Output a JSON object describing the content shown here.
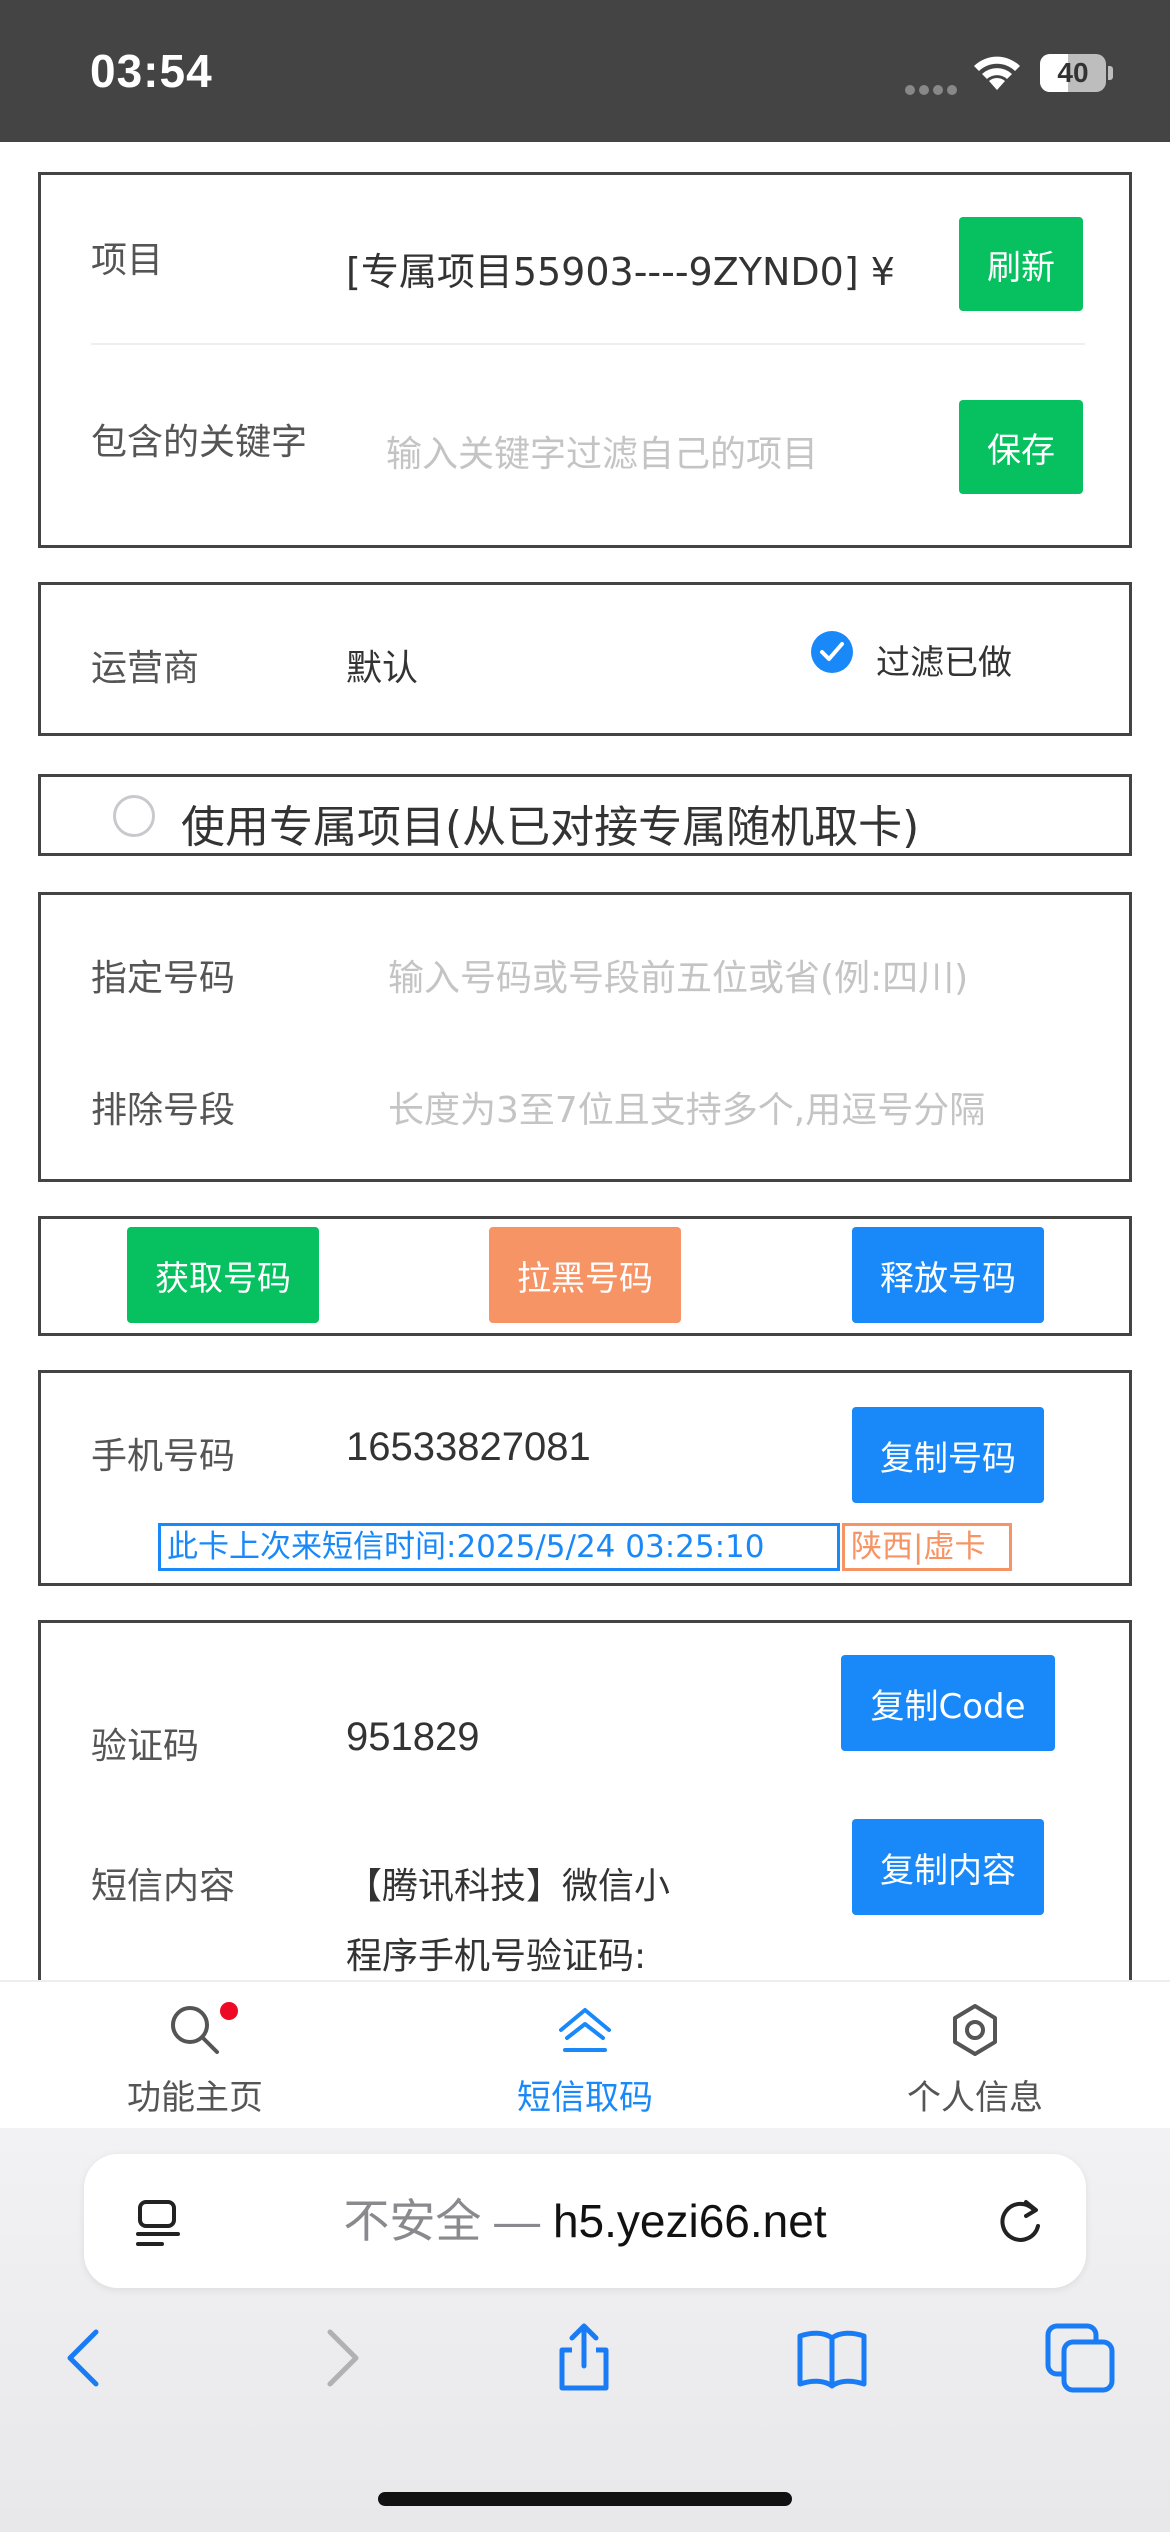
{
  "status_bar": {
    "time": "03:54",
    "battery": "40"
  },
  "project_card": {
    "project_label": "项目",
    "project_value": "[专属项目55903----9ZYND0] ¥",
    "refresh_label": "刷新",
    "keyword_label": "包含的关键字",
    "keyword_placeholder": "输入关键字过滤自己的项目",
    "save_label": "保存"
  },
  "carrier_card": {
    "carrier_label": "运营商",
    "carrier_value": "默认",
    "filter_label": "过滤已做"
  },
  "exclusive_option": {
    "label": "使用专属项目(从已对接专属随机取卡)"
  },
  "number_card": {
    "specify_label": "指定号码",
    "specify_placeholder": "输入号码或号段前五位或省(例:四川)",
    "exclude_label": "排除号段",
    "exclude_placeholder": "长度为3至7位且支持多个,用逗号分隔"
  },
  "actions": {
    "get_label": "获取号码",
    "block_label": "拉黑号码",
    "release_label": "释放号码"
  },
  "phone_card": {
    "phone_label": "手机号码",
    "phone_value": "16533827081",
    "copy_label": "复制号码",
    "last_sms_tag": "此卡上次来短信时间:2025/5/24 03:25:10",
    "region_tag": "陕西|虚卡"
  },
  "code_card": {
    "code_label": "验证码",
    "code_value": "951829",
    "copy_code_label": "复制Code",
    "sms_label": "短信内容",
    "sms_line1": "【腾讯科技】微信小",
    "sms_line2": "程序手机号验证码:",
    "copy_content_label": "复制内容"
  },
  "tabbar": {
    "tabs": [
      {
        "label": "功能主页",
        "icon": "search-icon"
      },
      {
        "label": "短信取码",
        "icon": "home-icon"
      },
      {
        "label": "个人信息",
        "icon": "gear-icon"
      }
    ]
  },
  "browser": {
    "insecure_label": "不安全 — ",
    "domain": "h5.yezi66.net"
  },
  "colors": {
    "green": "#07c160",
    "orange": "#f79466",
    "blue": "#1989fa"
  }
}
